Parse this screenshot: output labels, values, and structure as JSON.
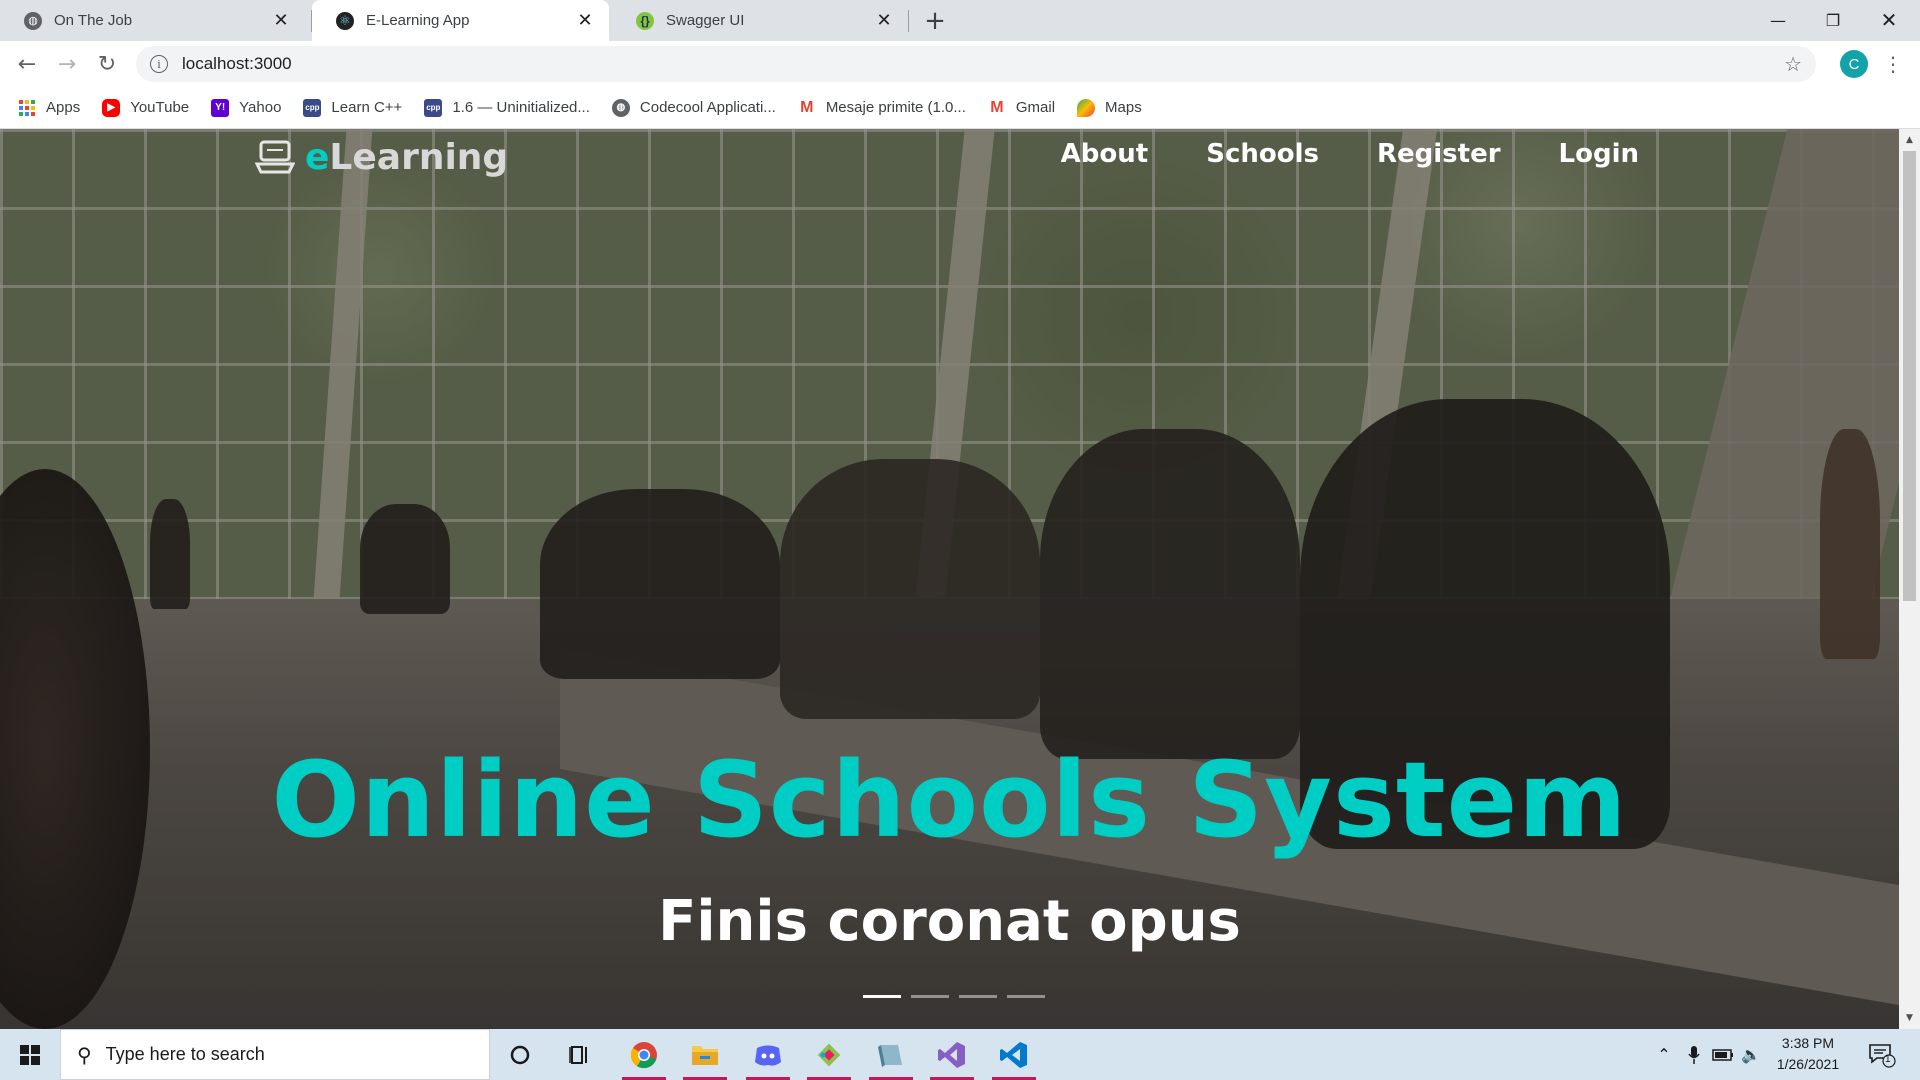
{
  "browser": {
    "tabs": [
      {
        "title": "On The Job",
        "active": false
      },
      {
        "title": "E-Learning App",
        "active": true
      },
      {
        "title": "Swagger UI",
        "active": false
      }
    ],
    "url": "localhost:3000",
    "profile_initial": "C",
    "bookmarks": [
      {
        "label": "Apps",
        "icon": "apps-grid-icon"
      },
      {
        "label": "YouTube",
        "icon": "youtube-icon"
      },
      {
        "label": "Yahoo",
        "icon": "yahoo-icon"
      },
      {
        "label": "Learn C++",
        "icon": "cpp-icon"
      },
      {
        "label": "1.6 — Uninitialized...",
        "icon": "cpp-icon"
      },
      {
        "label": "Codecool Applicati...",
        "icon": "globe-icon"
      },
      {
        "label": "Mesaje primite (1.0...",
        "icon": "gmail-icon"
      },
      {
        "label": "Gmail",
        "icon": "gmail-icon"
      },
      {
        "label": "Maps",
        "icon": "maps-icon"
      }
    ]
  },
  "site": {
    "brand_first": "e",
    "brand_rest": "Learning",
    "nav": [
      "About",
      "Schools",
      "Register",
      "Login"
    ],
    "hero_title": "Online Schools System",
    "hero_subtitle": "Finis coronat opus",
    "carousel": {
      "slides": 4,
      "active": 1
    },
    "accent_color": "#00cec4"
  },
  "taskbar": {
    "search_placeholder": "Type here to search",
    "time": "3:38 PM",
    "date": "1/26/2021",
    "notification_count": "1",
    "apps": [
      "chrome-icon",
      "file-explorer-icon",
      "discord-icon",
      "git-icon",
      "app-icon",
      "visual-studio-icon",
      "vscode-icon"
    ]
  }
}
